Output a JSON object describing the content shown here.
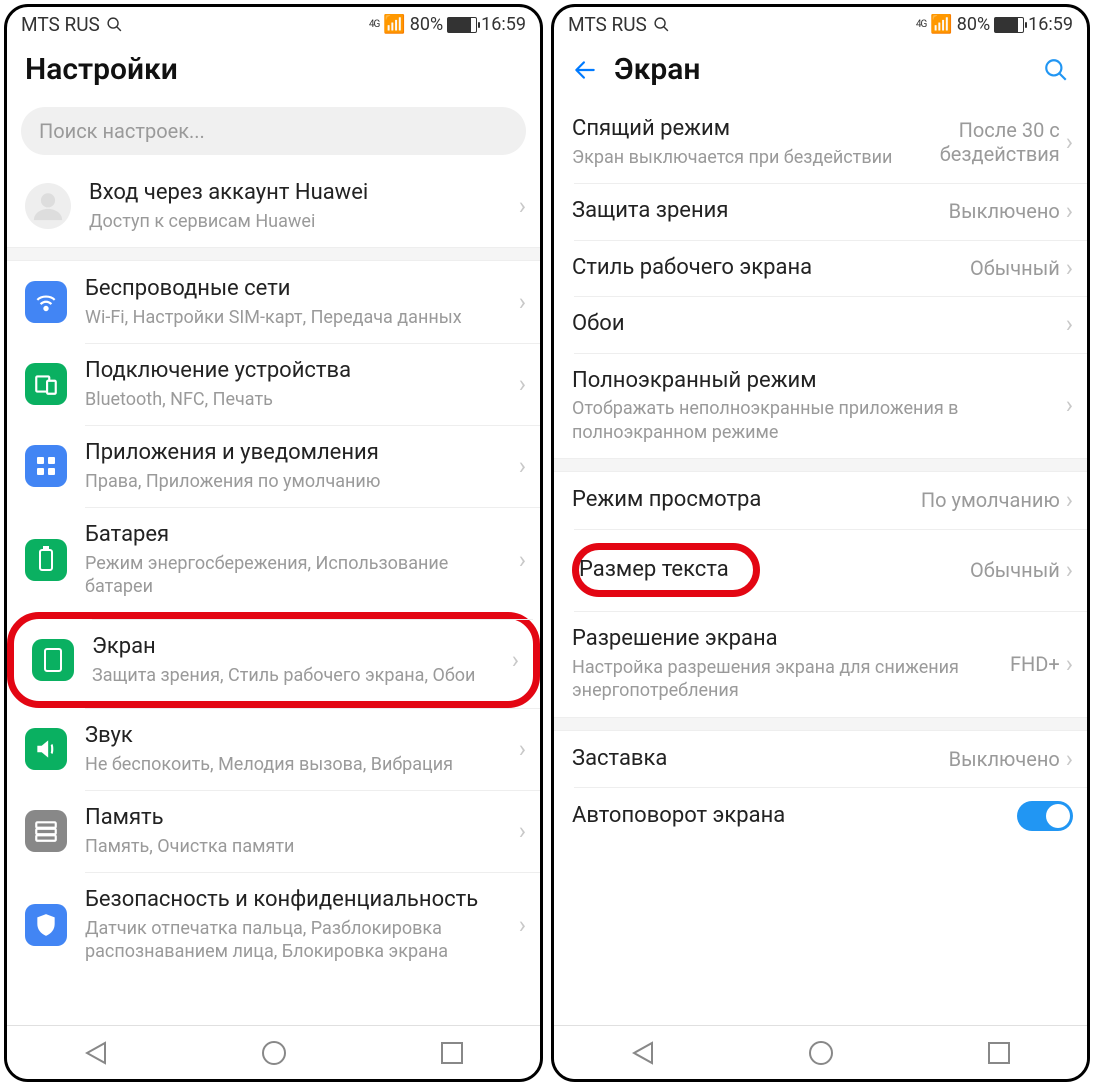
{
  "status": {
    "carrier": "MTS RUS",
    "net": "4G",
    "battery_pct": "80%",
    "time": "16:59"
  },
  "left": {
    "title": "Настройки",
    "search_placeholder": "Поиск настроек...",
    "account": {
      "title": "Вход через аккаунт Huawei",
      "sub": "Доступ к сервисам Huawei"
    },
    "items": [
      {
        "title": "Беспроводные сети",
        "sub": "Wi-Fi, Настройки SIM-карт, Передача данных"
      },
      {
        "title": "Подключение устройства",
        "sub": "Bluetooth, NFC, Печать"
      },
      {
        "title": "Приложения и уведомления",
        "sub": "Права, Приложения по умолчанию"
      },
      {
        "title": "Батарея",
        "sub": "Режим энергосбережения, Использование батареи"
      },
      {
        "title": "Экран",
        "sub": "Защита зрения, Стиль рабочего экрана, Обои"
      },
      {
        "title": "Звук",
        "sub": "Не беспокоить, Мелодия вызова, Вибрация"
      },
      {
        "title": "Память",
        "sub": "Память, Очистка памяти"
      },
      {
        "title": "Безопасность и конфиденциальность",
        "sub": "Датчик отпечатка пальца, Разблокировка распознаванием лица, Блокировка экрана"
      }
    ]
  },
  "right": {
    "title": "Экран",
    "groups": [
      [
        {
          "title": "Спящий режим",
          "sub": "Экран выключается при бездействии",
          "value": "После 30 с бездействия"
        },
        {
          "title": "Защита зрения",
          "value": "Выключено"
        },
        {
          "title": "Стиль рабочего экрана",
          "value": "Обычный"
        },
        {
          "title": "Обои"
        },
        {
          "title": "Полноэкранный режим",
          "sub": "Отображать неполноэкранные приложения в полноэкранном режиме"
        }
      ],
      [
        {
          "title": "Режим просмотра",
          "value": "По умолчанию"
        },
        {
          "title": "Размер текста",
          "value": "Обычный",
          "highlight": true
        },
        {
          "title": "Разрешение экрана",
          "sub": "Настройка разрешения экрана для снижения энергопотребления",
          "value": "FHD+"
        }
      ],
      [
        {
          "title": "Заставка",
          "value": "Выключено"
        },
        {
          "title": "Автоповорот экрана",
          "toggle": true
        }
      ]
    ]
  }
}
